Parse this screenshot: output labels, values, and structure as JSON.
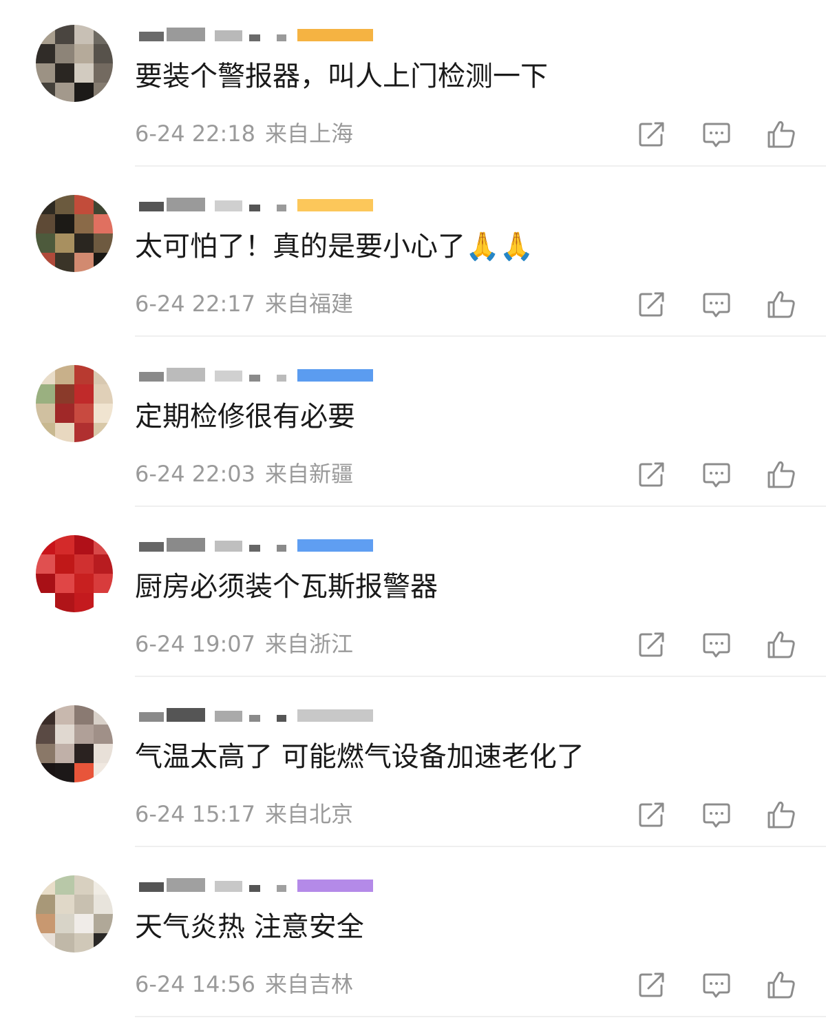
{
  "comments": [
    {
      "text": "要装个警报器，叫人上门检测一下",
      "time": "6-24 22:18",
      "location": "来自上海",
      "avatar": [
        "#a89e8e",
        "#4a4540",
        "#c8c0b5",
        "#6e6a62",
        "#302c28",
        "#8d8478",
        "#b5aa9a",
        "#57524b",
        "#9c9284",
        "#2a2622",
        "#d2cbc0",
        "#736a60",
        "#44403a",
        "#a3998c",
        "#1c1a18",
        "#857c70"
      ],
      "name_colors": [
        "#6a6a6a",
        "#9a9a9a",
        "#b9b9b9",
        "#f5b342"
      ]
    },
    {
      "text": "太可怕了！真的是要小心了",
      "emoji": "🙏🙏",
      "time": "6-24 22:17",
      "location": "来自福建",
      "avatar": [
        "#2e2a22",
        "#6b5a3e",
        "#c24c3a",
        "#3f4532",
        "#5e4a36",
        "#1c1a16",
        "#8a6a48",
        "#e07060",
        "#4d5a3c",
        "#a89060",
        "#2a2620",
        "#6e5a40",
        "#b04a3a",
        "#3a3428",
        "#d28a70",
        "#1a1814"
      ],
      "name_colors": [
        "#555555",
        "#9a9a9a",
        "#cfcfcf",
        "#fcc75a"
      ]
    },
    {
      "text": "定期检修很有必要",
      "time": "6-24 22:03",
      "location": "来自新疆",
      "avatar": [
        "#e8dcc8",
        "#c8b08a",
        "#b83a30",
        "#d8c8b0",
        "#9ab080",
        "#8a3a2a",
        "#c02a2a",
        "#e0d0b8",
        "#d0c0a0",
        "#a02828",
        "#c84a40",
        "#f0e4d0",
        "#c8b890",
        "#e8d8c0",
        "#b03030",
        "#d8c8a8"
      ],
      "name_colors": [
        "#8a8a8a",
        "#bbbbbb",
        "#d0d0d0",
        "#5b9cf0"
      ]
    },
    {
      "text": "厨房必须装个瓦斯报警器",
      "time": "6-24 19:07",
      "location": "来自浙江",
      "avatar": [
        "#c8141a",
        "#d42a2a",
        "#b01018",
        "#d84848",
        "#e05050",
        "#c01818",
        "#d03030",
        "#b81c20",
        "#a81016",
        "#e04646",
        "#c82020",
        "#d83c3c",
        "#ffffff",
        "#b01418",
        "#c41a1e",
        "#ffffff"
      ],
      "name_colors": [
        "#666666",
        "#8a8a8a",
        "#bfbfbf",
        "#5f9ef2"
      ]
    },
    {
      "text": "气温太高了 可能燃气设备加速老化了",
      "time": "6-24 15:17",
      "location": "来自北京",
      "avatar": [
        "#3a2c28",
        "#c8b8ae",
        "#8a7a72",
        "#d8d0c8",
        "#5a4a44",
        "#e0d8d0",
        "#b0a098",
        "#a09088",
        "#8a7868",
        "#c0b0a8",
        "#2a2220",
        "#e8e0d8",
        "#1a1414",
        "#1c1818",
        "#e8553a",
        "#f0e8e0"
      ],
      "name_colors": [
        "#8a8a8a",
        "#555555",
        "#aaaaaa",
        "#c8c8c8"
      ]
    },
    {
      "text": "天气炎热 注意安全",
      "time": "6-24 14:56",
      "location": "来自吉林",
      "avatar": [
        "#e8ddc8",
        "#b8c8a8",
        "#d8d0c0",
        "#f0ece4",
        "#a89878",
        "#e0d8c8",
        "#c8c0b0",
        "#e8e4dc",
        "#c89870",
        "#d8d4c8",
        "#f0ece8",
        "#b0a898",
        "#e8e0d8",
        "#c0b8a8",
        "#d0c8b8",
        "#2a2826"
      ],
      "name_colors": [
        "#555555",
        "#a0a0a0",
        "#c8c8c8",
        "#b48ae8"
      ]
    }
  ],
  "actions": {
    "share_icon": "share-icon",
    "comment_icon": "comment-icon",
    "like_icon": "like-thumb-icon"
  }
}
